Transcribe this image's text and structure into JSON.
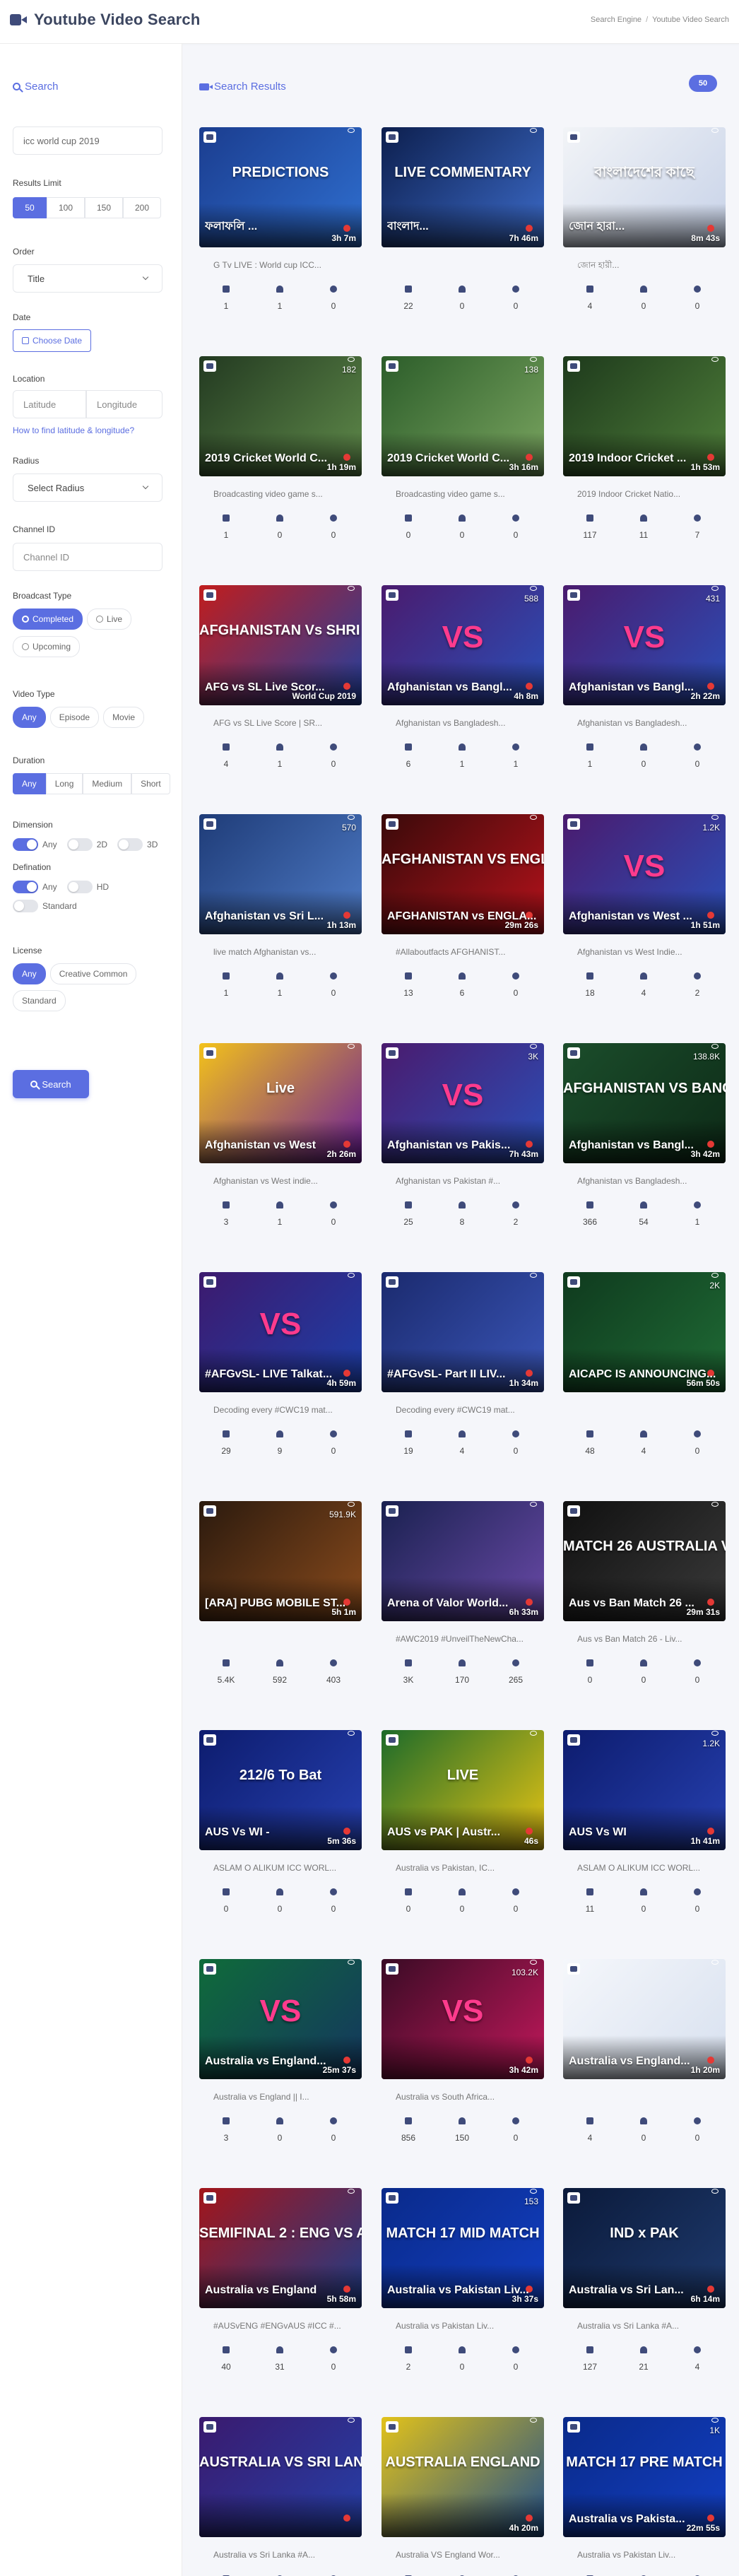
{
  "app": {
    "title": "Youtube Video Search"
  },
  "breadcrumb": [
    "Search Engine",
    "Youtube Video Search"
  ],
  "sidebar": {
    "heading": "Search",
    "query": "icc world cup 2019",
    "results_limit": {
      "label": "Results Limit",
      "options": [
        "50",
        "100",
        "150",
        "200"
      ],
      "selected": "50"
    },
    "order": {
      "label": "Order",
      "value": "Title"
    },
    "date": {
      "label": "Date",
      "button": "Choose Date"
    },
    "location": {
      "label": "Location",
      "lat_placeholder": "Latitude",
      "lng_placeholder": "Longitude",
      "help_link": "How to find latitude & longitude?"
    },
    "radius": {
      "label": "Radius",
      "value": "Select Radius"
    },
    "channel": {
      "label": "Channel ID",
      "placeholder": "Channel ID"
    },
    "broadcast": {
      "label": "Broadcast Type",
      "options": [
        "Completed",
        "Live",
        "Upcoming"
      ],
      "selected": "Completed"
    },
    "video_type": {
      "label": "Video Type",
      "options": [
        "Any",
        "Episode",
        "Movie"
      ],
      "selected": "Any"
    },
    "duration": {
      "label": "Duration",
      "options": [
        "Any",
        "Long",
        "Medium",
        "Short"
      ],
      "selected": "Any"
    },
    "dimension": {
      "label": "Dimension",
      "options": [
        "Any",
        "2D",
        "3D"
      ],
      "selected": "Any"
    },
    "defination": {
      "label": "Defination",
      "options": [
        "Any",
        "HD",
        "Standard"
      ],
      "selected": "Any"
    },
    "license": {
      "label": "License",
      "options": [
        "Any",
        "Creative Common",
        "Standard"
      ],
      "selected": "Any"
    },
    "search_button": "Search"
  },
  "results": {
    "heading": "Search Results",
    "count": "50",
    "cards": [
      {
        "overlay": "ফলাফলি ...",
        "duration": "3h 7m",
        "views": "",
        "desc": "G Tv LIVE : World cup ICC...",
        "likes": "1",
        "dislikes": "1",
        "comments": "0",
        "art": "PREDICTIONS",
        "colors": [
          "#1b3d8f",
          "#2f6fd0"
        ]
      },
      {
        "overlay": "বাংলাদ...",
        "duration": "7h 46m",
        "views": "",
        "desc": "",
        "likes": "22",
        "dislikes": "0",
        "comments": "0",
        "art": "LIVE COMMENTARY",
        "colors": [
          "#0d1f4e",
          "#3c6bc9"
        ]
      },
      {
        "overlay": "জোন হারা...",
        "duration": "8m 43s",
        "views": "",
        "desc": "জোন হারী...",
        "likes": "4",
        "dislikes": "0",
        "comments": "0",
        "art": "বাংলাদেশের কাছে",
        "colors": [
          "#f2f4f7",
          "#c7d2e8"
        ]
      },
      {
        "overlay": "2019 Cricket World C...",
        "duration": "1h 19m",
        "views": "182",
        "desc": "Broadcasting video game s...",
        "likes": "1",
        "dislikes": "0",
        "comments": "0",
        "art": "",
        "colors": [
          "#233a21",
          "#5f8a4a"
        ]
      },
      {
        "overlay": "2019 Cricket World C...",
        "duration": "3h 16m",
        "views": "138",
        "desc": "Broadcasting video game s...",
        "likes": "0",
        "dislikes": "0",
        "comments": "0",
        "art": "",
        "colors": [
          "#2c5d2a",
          "#7aa560"
        ]
      },
      {
        "overlay": "2019 Indoor Cricket ...",
        "duration": "1h 53m",
        "views": "",
        "desc": "2019 Indoor Cricket Natio...",
        "likes": "117",
        "dislikes": "11",
        "comments": "7",
        "art": "",
        "colors": [
          "#1e3a1c",
          "#4f7f3a"
        ]
      },
      {
        "overlay": "AFG vs SL Live Scor...",
        "duration": "World Cup 2019",
        "views": "",
        "desc": "AFG vs SL Live Score | SR...",
        "likes": "4",
        "dislikes": "1",
        "comments": "0",
        "art": "AFGHANISTAN Vs SHRI LANKA",
        "colors": [
          "#c11d1d",
          "#2040a0"
        ]
      },
      {
        "overlay": "Afghanistan vs Bangl...",
        "duration": "4h 8m",
        "views": "588",
        "desc": "Afghanistan vs Bangladesh...",
        "likes": "6",
        "dislikes": "1",
        "comments": "1",
        "art": "VS",
        "colors": [
          "#4a1b6e",
          "#2a4fb8"
        ]
      },
      {
        "overlay": "Afghanistan vs Bangl...",
        "duration": "2h 22m",
        "views": "431",
        "desc": "Afghanistan vs Bangladesh...",
        "likes": "1",
        "dislikes": "0",
        "comments": "0",
        "art": "VS",
        "colors": [
          "#4a1b6e",
          "#2a4fb8"
        ]
      },
      {
        "overlay": "Afghanistan vs Sri L...",
        "duration": "1h 13m",
        "views": "570",
        "desc": "live match Afghanistan vs...",
        "likes": "1",
        "dislikes": "1",
        "comments": "0",
        "art": "",
        "colors": [
          "#1f3c78",
          "#4e7bc6"
        ]
      },
      {
        "overlay": "AFGHANISTAN vs ENGLA...",
        "duration": "29m 26s",
        "views": "",
        "desc": "#Allaboutfacts AFGHANIST...",
        "likes": "13",
        "dislikes": "6",
        "comments": "0",
        "art": "AFGHANISTAN VS ENGLAND",
        "colors": [
          "#3a0a0a",
          "#b5121b"
        ]
      },
      {
        "overlay": "Afghanistan vs West ...",
        "duration": "1h 51m",
        "views": "1.2K",
        "desc": "Afghanistan vs West Indie...",
        "likes": "18",
        "dislikes": "4",
        "comments": "2",
        "art": "VS",
        "colors": [
          "#4a1b6e",
          "#2a4fb8"
        ]
      },
      {
        "overlay": "Afghanistan vs West",
        "duration": "2h 26m",
        "views": "",
        "desc": "Afghanistan vs West indie...",
        "likes": "3",
        "dislikes": "1",
        "comments": "0",
        "art": "Live",
        "colors": [
          "#f3c21a",
          "#6a1b9a"
        ]
      },
      {
        "overlay": "Afghanistan vs Pakis...",
        "duration": "7h 43m",
        "views": "3K",
        "desc": "Afghanistan vs Pakistan #...",
        "likes": "25",
        "dislikes": "8",
        "comments": "2",
        "art": "VS",
        "colors": [
          "#4a1b6e",
          "#2a4fb8"
        ]
      },
      {
        "overlay": "Afghanistan vs Bangl...",
        "duration": "3h 42m",
        "views": "138.8K",
        "desc": "Afghanistan vs Bangladesh...",
        "likes": "366",
        "dislikes": "54",
        "comments": "1",
        "art": "AFGHANISTAN VS BANGLADESH",
        "colors": [
          "#1b4d2b",
          "#0d2a17"
        ]
      },
      {
        "overlay": "#AFGvSL- LIVE Talkat...",
        "duration": "4h 59m",
        "views": "",
        "desc": "Decoding every #CWC19 mat...",
        "likes": "29",
        "dislikes": "9",
        "comments": "0",
        "art": "VS",
        "colors": [
          "#3d1a6e",
          "#1c3fa8"
        ]
      },
      {
        "overlay": "#AFGvSL- Part II LIV...",
        "duration": "1h 34m",
        "views": "",
        "desc": "Decoding every #CWC19 mat...",
        "likes": "19",
        "dislikes": "4",
        "comments": "0",
        "art": "",
        "colors": [
          "#1b2a6e",
          "#3a56b8"
        ]
      },
      {
        "overlay": "AICAPC IS ANNOUNCING...",
        "duration": "56m 50s",
        "views": "2K",
        "desc": "",
        "likes": "48",
        "dislikes": "4",
        "comments": "0",
        "art": "",
        "colors": [
          "#0f3a1e",
          "#1f6b35"
        ]
      },
      {
        "overlay": "[ARA] PUBG MOBILE ST...",
        "duration": "5h 1m",
        "views": "591.9K",
        "desc": "",
        "likes": "5.4K",
        "dislikes": "592",
        "comments": "403",
        "art": "",
        "colors": [
          "#2b1a0e",
          "#8a4b1c"
        ]
      },
      {
        "overlay": "Arena of Valor World...",
        "duration": "6h 33m",
        "views": "",
        "desc": "#AWC2019 #UnveilTheNewCha...",
        "likes": "3K",
        "dislikes": "170",
        "comments": "265",
        "art": "",
        "colors": [
          "#1a2150",
          "#6a4aa8"
        ]
      },
      {
        "overlay": "Aus vs Ban Match 26 ...",
        "duration": "29m 31s",
        "views": "",
        "desc": "Aus vs Ban Match 26 - Liv...",
        "likes": "0",
        "dislikes": "0",
        "comments": "0",
        "art": "MATCH 26 AUSTRALIA VS BANGLADESH",
        "colors": [
          "#101010",
          "#3a3a3a"
        ]
      },
      {
        "overlay": "AUS Vs WI -",
        "duration": "5m 36s",
        "views": "",
        "desc": "ASLAM O ALIKUM ICC WORL...",
        "likes": "0",
        "dislikes": "0",
        "comments": "0",
        "art": "212/6 To Bat",
        "colors": [
          "#0d1c6e",
          "#2640b0"
        ]
      },
      {
        "overlay": "AUS vs PAK | Austr...",
        "duration": "46s",
        "views": "",
        "desc": "Australia vs Pakistan, IC...",
        "likes": "0",
        "dislikes": "0",
        "comments": "0",
        "art": "LIVE",
        "colors": [
          "#1d6b2a",
          "#e8c414"
        ]
      },
      {
        "overlay": "AUS Vs WI",
        "duration": "1h 41m",
        "views": "1.2K",
        "desc": "ASLAM O ALIKUM ICC WORL...",
        "likes": "11",
        "dislikes": "0",
        "comments": "0",
        "art": "",
        "colors": [
          "#0d1c6e",
          "#2640b0"
        ]
      },
      {
        "overlay": "Australia vs England...",
        "duration": "25m 37s",
        "views": "",
        "desc": "Australia vs England || I...",
        "likes": "3",
        "dislikes": "0",
        "comments": "0",
        "art": "VS",
        "colors": [
          "#0f6b3a",
          "#14365f"
        ]
      },
      {
        "overlay": "",
        "duration": "3h 42m",
        "views": "103.2K",
        "desc": "Australia vs South Africa...",
        "likes": "856",
        "dislikes": "150",
        "comments": "0",
        "art": "VS",
        "colors": [
          "#3a0b25",
          "#c2185b"
        ]
      },
      {
        "overlay": "Australia vs England...",
        "duration": "1h 20m",
        "views": "",
        "desc": "",
        "likes": "4",
        "dislikes": "0",
        "comments": "0",
        "art": "",
        "colors": [
          "#f5f7fb",
          "#d7e0ef"
        ]
      },
      {
        "overlay": "Australia vs England",
        "duration": "5h 58m",
        "views": "",
        "desc": "#AUSvENG #ENGvAUS #ICC #...",
        "likes": "40",
        "dislikes": "31",
        "comments": "0",
        "art": "SEMIFINAL 2 : ENG VS AUS",
        "colors": [
          "#a3151a",
          "#1d3d8a"
        ]
      },
      {
        "overlay": "Australia vs Pakistan Liv...",
        "duration": "3h 37s",
        "views": "153",
        "desc": "Australia vs Pakistan Liv...",
        "likes": "2",
        "dislikes": "0",
        "comments": "0",
        "art": "MATCH 17 MID MATCH",
        "colors": [
          "#0a2a8a",
          "#123fc2"
        ]
      },
      {
        "overlay": "Australia vs Sri Lan...",
        "duration": "6h 14m",
        "views": "",
        "desc": "Australia vs Sri Lanka #A...",
        "likes": "127",
        "dislikes": "21",
        "comments": "4",
        "art": "IND x PAK",
        "colors": [
          "#0b1a3a",
          "#1e3a6e"
        ]
      },
      {
        "overlay": "",
        "duration": "",
        "views": "",
        "desc": "Australia vs Sri Lanka #A...",
        "likes": "",
        "dislikes": "",
        "comments": "",
        "art": "AUSTRALIA VS SRI LANKA",
        "colors": [
          "#3a1a6e",
          "#2540a8"
        ]
      },
      {
        "overlay": "",
        "duration": "4h 20m",
        "views": "",
        "desc": "Australia VS England Wor...",
        "likes": "",
        "dislikes": "",
        "comments": "",
        "art": "AUSTRALIA ENGLAND",
        "colors": [
          "#e2c21a",
          "#1e4d8a"
        ]
      },
      {
        "overlay": "Australia vs Pakista...",
        "duration": "22m 55s",
        "views": "1K",
        "desc": "Australia vs Pakistan Liv...",
        "likes": "",
        "dislikes": "",
        "comments": "",
        "art": "MATCH 17 PRE MATCH",
        "colors": [
          "#0a2a8a",
          "#123fc2"
        ]
      }
    ]
  }
}
